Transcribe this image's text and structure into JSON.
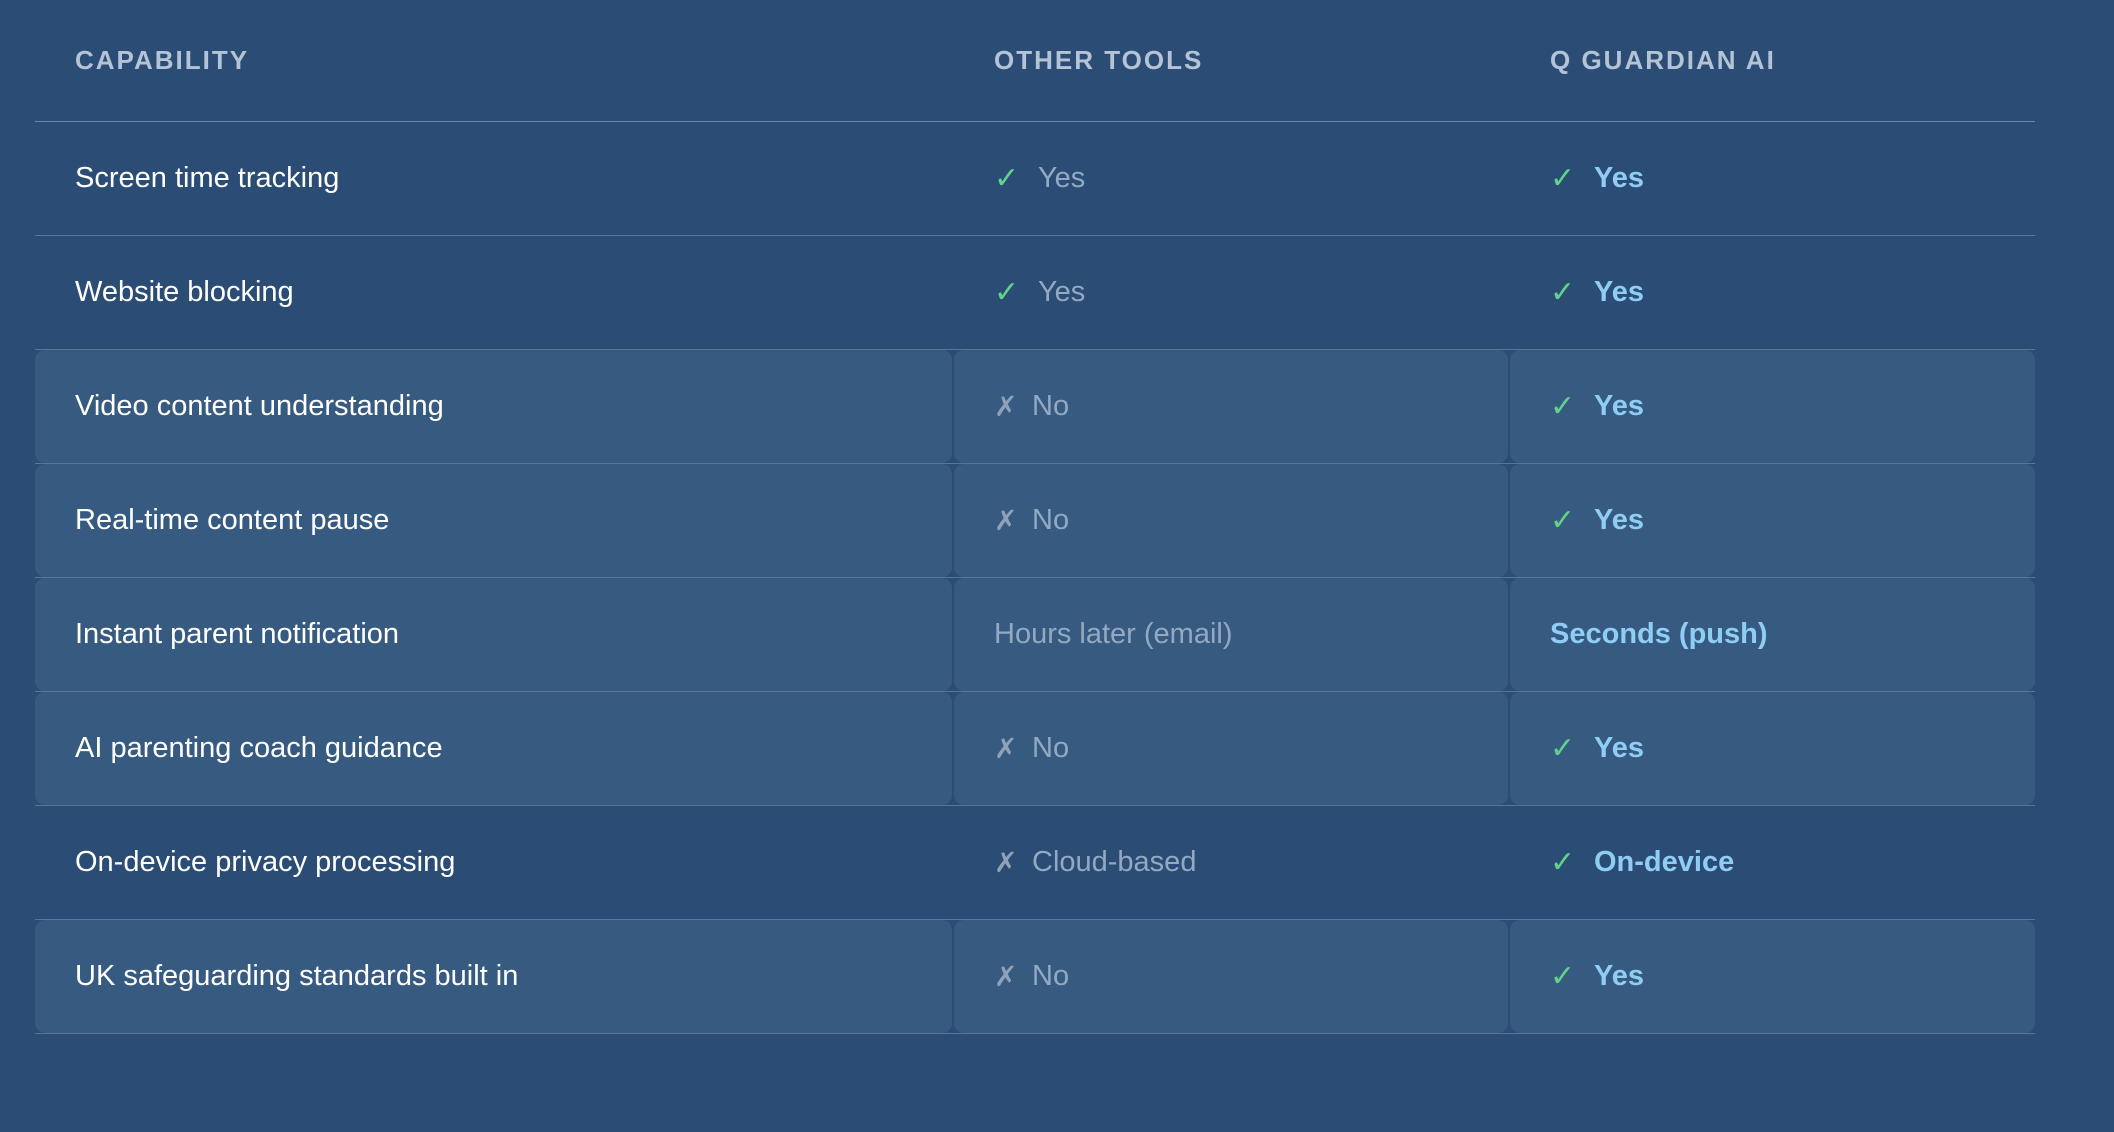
{
  "header": {
    "col1": "Capability",
    "col2": "Other Tools",
    "col3": "Q Guardian AI"
  },
  "icons": {
    "check": "✓",
    "cross": "✗"
  },
  "colors": {
    "background": "#2b4d75",
    "highlight_row": "#375a80",
    "check": "#62d28a",
    "accent": "#8fcdf5"
  },
  "rows": [
    {
      "capability": "Screen time tracking",
      "other": "Yes",
      "other_icon": "check-icon",
      "ours": "Yes",
      "ours_icon": "check-icon",
      "highlight": false
    },
    {
      "capability": "Website blocking",
      "other": "Yes",
      "other_icon": "check-icon",
      "ours": "Yes",
      "ours_icon": "check-icon",
      "highlight": false
    },
    {
      "capability": "Video content understanding",
      "other": "No",
      "other_icon": "cross-icon",
      "ours": "Yes",
      "ours_icon": "check-icon",
      "highlight": true
    },
    {
      "capability": "Real-time content pause",
      "other": "No",
      "other_icon": "cross-icon",
      "ours": "Yes",
      "ours_icon": "check-icon",
      "highlight": true
    },
    {
      "capability": "Instant parent notification",
      "other": "Hours later (email)",
      "other_icon": "none",
      "ours": "Seconds (push)",
      "ours_icon": "none",
      "highlight": true
    },
    {
      "capability": "AI parenting coach guidance",
      "other": "No",
      "other_icon": "cross-icon",
      "ours": "Yes",
      "ours_icon": "check-icon",
      "highlight": true
    },
    {
      "capability": "On-device privacy processing",
      "other": "Cloud-based",
      "other_icon": "cross-icon",
      "ours": "On-device",
      "ours_icon": "check-icon",
      "highlight": false
    },
    {
      "capability": "UK safeguarding standards built in",
      "other": "No",
      "other_icon": "cross-icon",
      "ours": "Yes",
      "ours_icon": "check-icon",
      "highlight": true
    }
  ]
}
